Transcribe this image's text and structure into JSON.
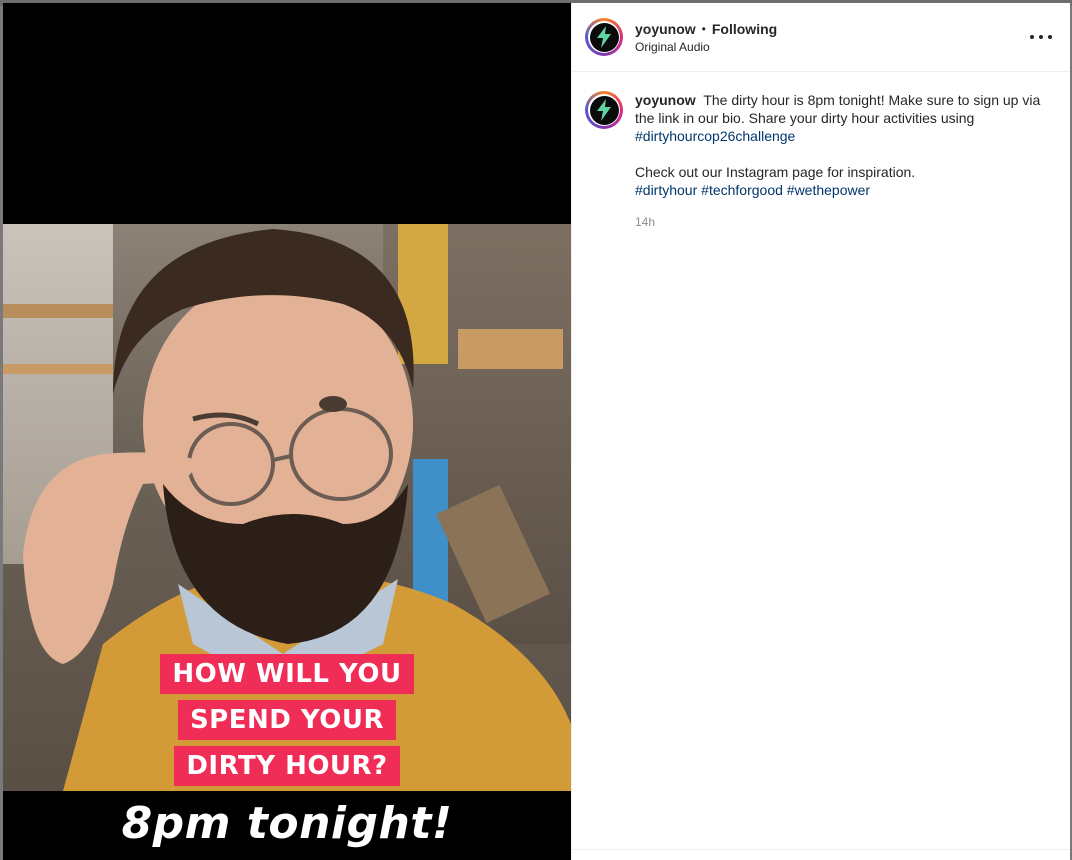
{
  "header": {
    "username": "yoyunow",
    "separator": "•",
    "follow_status": "Following",
    "audio_label": "Original Audio"
  },
  "caption": {
    "username": "yoyunow",
    "text_1": "The dirty hour is 8pm tonight! Make sure to sign up via the link in our bio. Share your dirty hour activities using",
    "hashtag_1": "#dirtyhourcop26challenge",
    "text_2": "Check out our Instagram page for inspiration.",
    "hashtags": [
      "#dirtyhour",
      "#techforgood",
      "#wethepower"
    ],
    "time": "14h"
  },
  "video": {
    "overlay_lines": [
      "HOW WILL YOU",
      "SPEND YOUR",
      "DIRTY HOUR?"
    ],
    "tagline": "8pm tonight!"
  },
  "colors": {
    "caption_bg": "#ef2d56",
    "hashtag": "#00376b",
    "avatar_bolt": "#5fd3a0"
  },
  "icons": {
    "avatar": "lightning-bolt-icon",
    "more": "more-options-icon"
  }
}
